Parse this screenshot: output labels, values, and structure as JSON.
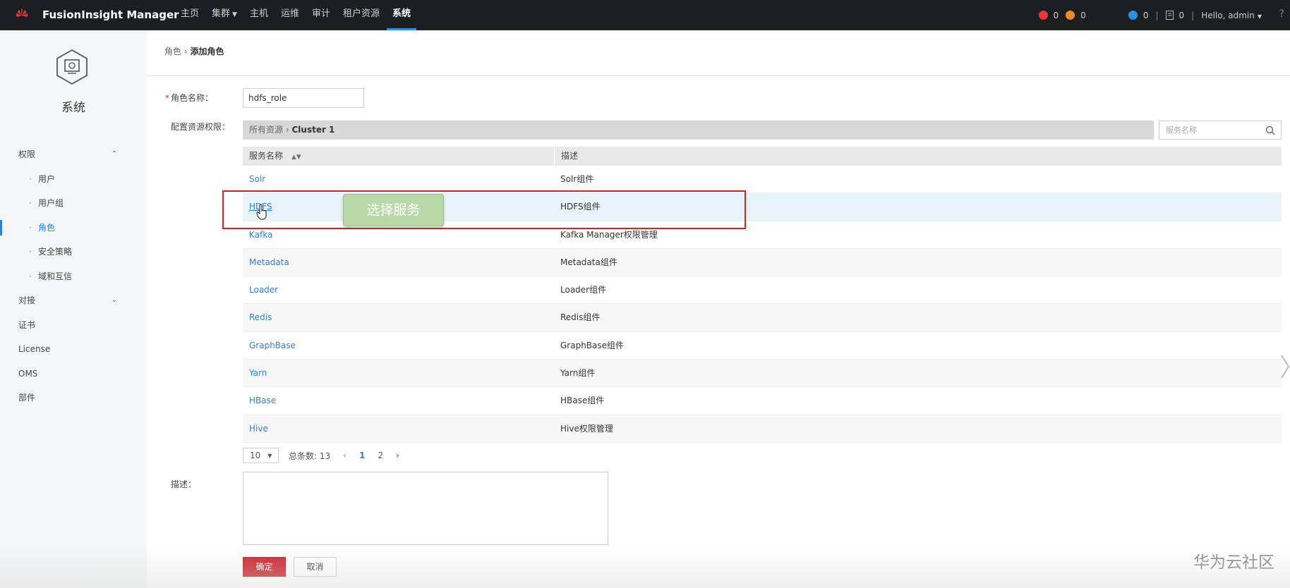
{
  "header": {
    "brand": "FusionInsight Manager",
    "nav": [
      {
        "label": "主页",
        "has_caret": false,
        "active": false
      },
      {
        "label": "集群",
        "has_caret": true,
        "active": false
      },
      {
        "label": "主机",
        "has_caret": false,
        "active": false
      },
      {
        "label": "运维",
        "has_caret": false,
        "active": false
      },
      {
        "label": "审计",
        "has_caret": false,
        "active": false
      },
      {
        "label": "租户资源",
        "has_caret": false,
        "active": false
      },
      {
        "label": "系统",
        "has_caret": false,
        "active": true
      }
    ],
    "alarms": {
      "critical": "0",
      "major": "0",
      "info": "0",
      "tasks": "0"
    },
    "user": "Hello, admin",
    "colors": {
      "critical": "#e53935",
      "major": "#f08a24",
      "info": "#2f8ee0"
    }
  },
  "sidebar": {
    "title": "系统",
    "items": [
      {
        "label": "权限",
        "level": 1,
        "chevron": "up"
      },
      {
        "label": "用户",
        "level": 2
      },
      {
        "label": "用户组",
        "level": 2
      },
      {
        "label": "角色",
        "level": 2,
        "active": true
      },
      {
        "label": "安全策略",
        "level": 2
      },
      {
        "label": "域和互信",
        "level": 2
      },
      {
        "label": "对接",
        "level": 1,
        "chevron": "down"
      },
      {
        "label": "证书",
        "level": 1
      },
      {
        "label": "License",
        "level": 1
      },
      {
        "label": "OMS",
        "level": 1
      },
      {
        "label": "部件",
        "level": 1
      }
    ]
  },
  "breadcrumb": {
    "parent": "角色",
    "separator": "›",
    "current": "添加角色"
  },
  "form": {
    "role_name_label": "角色名称：",
    "role_name_value": "hdfs_role",
    "resource_label": "配置资源权限：",
    "resource_path_root": "所有资源",
    "resource_path_sep": "›",
    "resource_path_current": "Cluster 1",
    "search_placeholder": "服务名称",
    "description_label": "描述：",
    "ok_label": "确定",
    "cancel_label": "取消"
  },
  "table": {
    "headers": [
      "服务名称",
      "描述"
    ],
    "rows": [
      {
        "name": "Solr",
        "desc": "Solr组件"
      },
      {
        "name": "HDFS",
        "desc": "HDFS组件"
      },
      {
        "name": "Kafka",
        "desc": "Kafka Manager权限管理"
      },
      {
        "name": "Metadata",
        "desc": "Metadata组件"
      },
      {
        "name": "Loader",
        "desc": "Loader组件"
      },
      {
        "name": "Redis",
        "desc": "Redis组件"
      },
      {
        "name": "GraphBase",
        "desc": "GraphBase组件"
      },
      {
        "name": "Yarn",
        "desc": "Yarn组件"
      },
      {
        "name": "HBase",
        "desc": "HBase组件"
      },
      {
        "name": "Hive",
        "desc": "Hive权限管理"
      }
    ],
    "hover_row_index": 1
  },
  "pagination": {
    "page_size": "10",
    "total_label": "总条数: 13",
    "pages": [
      "1",
      "2"
    ],
    "current_page": "1"
  },
  "overlay": {
    "tooltip_text": "选择服务"
  },
  "watermark": "华为云社区"
}
